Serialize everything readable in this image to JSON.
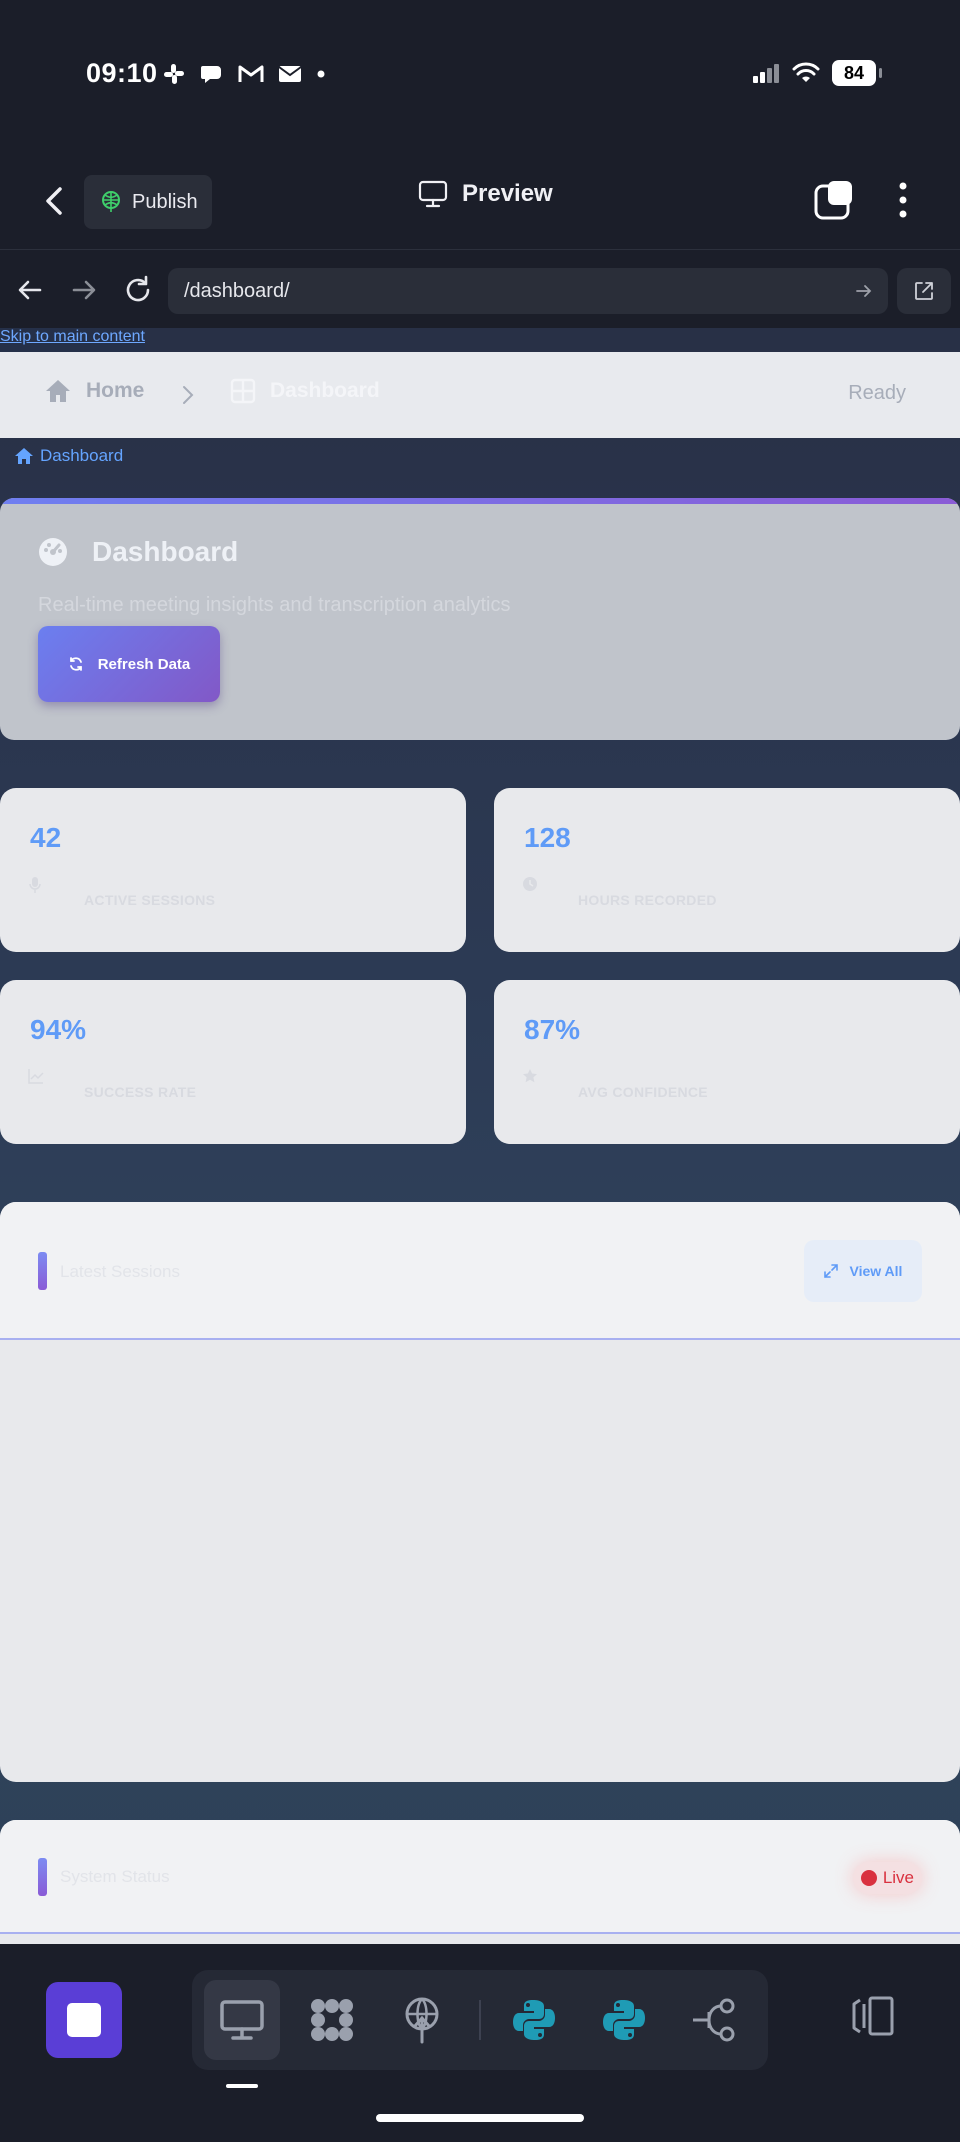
{
  "status_bar": {
    "time": "09:10",
    "battery": "84",
    "left_icons": [
      "slack-icon",
      "chat-bubble-icon",
      "gmail-icon",
      "mail-icon",
      "dot-icon"
    ],
    "right_icons": [
      "signal-icon",
      "wifi-icon",
      "battery-icon"
    ]
  },
  "app_header": {
    "publish_label": "Publish",
    "preview_label": "Preview"
  },
  "url_bar": {
    "path": "/dashboard/"
  },
  "page": {
    "skip_link": "Skip to main content",
    "topnav": {
      "home": "Home",
      "current": "Dashboard",
      "status": "Ready"
    },
    "breadcrumb": "Dashboard",
    "hero": {
      "title": "Dashboard",
      "subtitle": "Real-time meeting insights and transcription analytics",
      "refresh_label": "Refresh Data"
    },
    "stats": [
      {
        "value": "42",
        "label": "ACTIVE SESSIONS",
        "icon": "microphone-icon"
      },
      {
        "value": "128",
        "label": "HOURS RECORDED",
        "icon": "clock-icon"
      },
      {
        "value": "94%",
        "label": "SUCCESS RATE",
        "icon": "chart-line-icon"
      },
      {
        "value": "87%",
        "label": "AVG CONFIDENCE",
        "icon": "star-icon"
      }
    ],
    "recent_panel": {
      "title": "Latest Sessions",
      "view_all": "View All"
    },
    "status_panel": {
      "title": "System Status",
      "live": "Live"
    }
  },
  "colors": {
    "accent_blue": "#5f9bf7",
    "accent_purple": "#8258c7",
    "live_red": "#d9313f",
    "stop_purple": "#5a3ed6",
    "python_teal": "#1f9bb5"
  }
}
